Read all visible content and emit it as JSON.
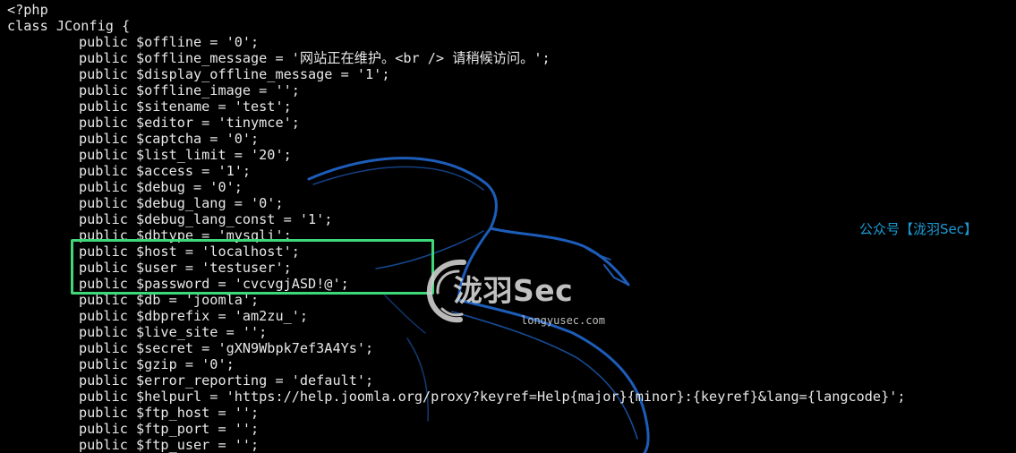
{
  "terminal": {
    "lines": [
      "<?php",
      "class JConfig {",
      "public $offline = '0';",
      "public $offline_message = '网站正在维护。<br /> 请稍候访问。';",
      "public $display_offline_message = '1';",
      "public $offline_image = '';",
      "public $sitename = 'test';",
      "public $editor = 'tinymce';",
      "public $captcha = '0';",
      "public $list_limit = '20';",
      "public $access = '1';",
      "public $debug = '0';",
      "public $debug_lang = '0';",
      "public $debug_lang_const = '1';",
      "public $dbtype = 'mysqli';",
      "public $host = 'localhost';",
      "public $user = 'testuser';",
      "public $password = 'cvcvgjASD!@';",
      "public $db = 'joomla';",
      "public $dbprefix = 'am2zu_';",
      "public $live_site = '';",
      "public $secret = 'gXN9Wbpk7ef3A4Ys';",
      "public $gzip = '0';",
      "public $error_reporting = 'default';",
      "public $helpurl = 'https://help.joomla.org/proxy?keyref=Help{major}{minor}:{keyref}&lang={langcode}';",
      "public $ftp_host = '';",
      "public $ftp_port = '';",
      "public $ftp_user = '';"
    ]
  },
  "watermark": {
    "wechat_tag": "公众号【泷羽Sec】",
    "brand": "泷羽Sec",
    "url": "longyusec.com"
  },
  "colors": {
    "terminal_bg": "#000000",
    "terminal_text": "#e8e8e8",
    "highlight_border": "#3ed87a",
    "dragon_blue": "#1f63c4",
    "wechat_blue": "#1d9bd6"
  },
  "icons": {
    "background": "kali-dragon-logo",
    "watermark_logo": "longyu-logo"
  }
}
